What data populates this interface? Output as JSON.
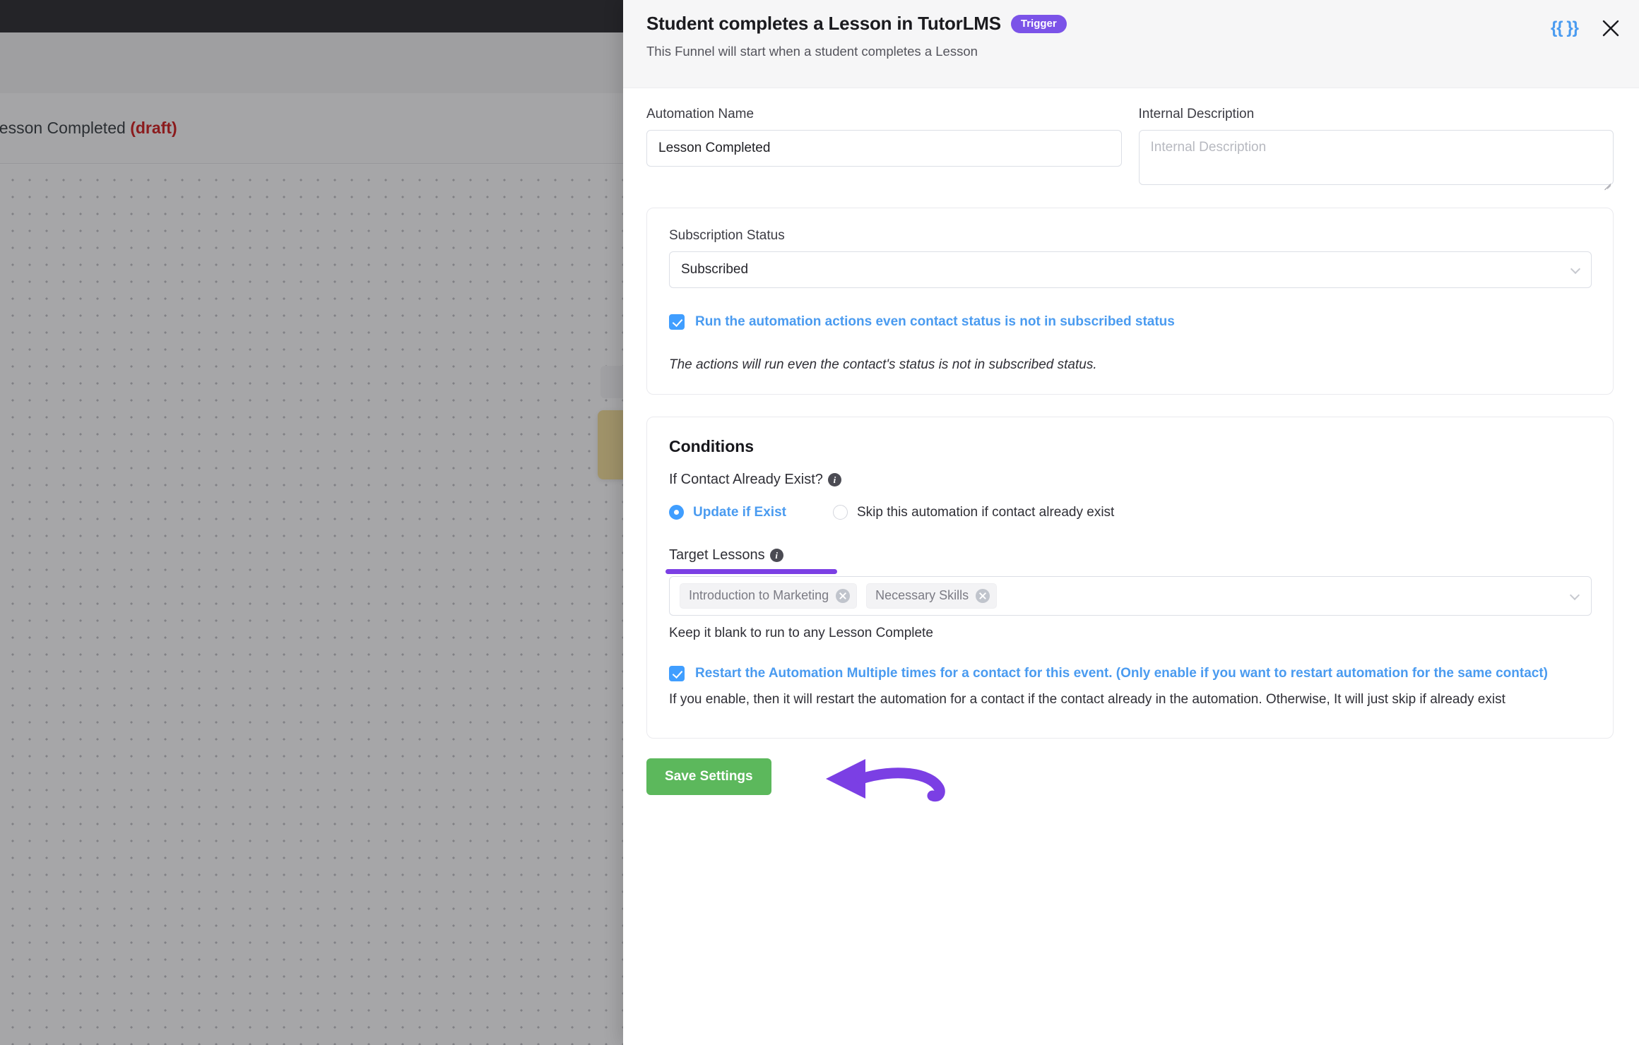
{
  "background": {
    "automation_title": "Lesson Completed ",
    "automation_state": "(draft)"
  },
  "header": {
    "title": "Student completes a Lesson in TutorLMS",
    "badge": "Trigger",
    "subtitle": "This Funnel will start when a student completes a Lesson",
    "smartcode_icon": "{{ }}",
    "close_icon": "close-icon"
  },
  "form": {
    "automation_name_label": "Automation Name",
    "automation_name_value": "Lesson Completed",
    "internal_description_label": "Internal Description",
    "internal_description_value": "",
    "internal_description_placeholder": "Internal Description"
  },
  "subscription": {
    "label": "Subscription Status",
    "selected": "Subscribed",
    "checkbox_label": "Run the automation actions even contact status is not in subscribed status",
    "checkbox_checked": true,
    "hint": "The actions will run even the contact's status is not in subscribed status."
  },
  "conditions": {
    "title": "Conditions",
    "contact_exist_label": "If Contact Already Exist?",
    "info_glyph": "i",
    "radios": [
      {
        "label": "Update if Exist",
        "selected": true
      },
      {
        "label": "Skip this automation if contact already exist",
        "selected": false
      }
    ],
    "target_lessons_label": "Target Lessons",
    "target_lessons_tags": [
      "Introduction to Marketing",
      "Necessary Skills"
    ],
    "target_lessons_hint": "Keep it blank to run to any Lesson Complete",
    "restart_label": "Restart the Automation Multiple times for a contact for this event. (Only enable if you want to restart automation for the same contact)",
    "restart_checked": true,
    "restart_hint": "If you enable, then it will restart the automation for a contact if the contact already in the automation. Otherwise, It will just skip if already exist"
  },
  "footer": {
    "save_label": "Save Settings"
  },
  "colors": {
    "accent_blue": "#409eff",
    "link_blue": "#4a9bf0",
    "badge_purple": "#7b53e8",
    "annotation_purple": "#7b3fe4",
    "save_green": "#5cb85c",
    "draft_red": "#cc0000"
  }
}
